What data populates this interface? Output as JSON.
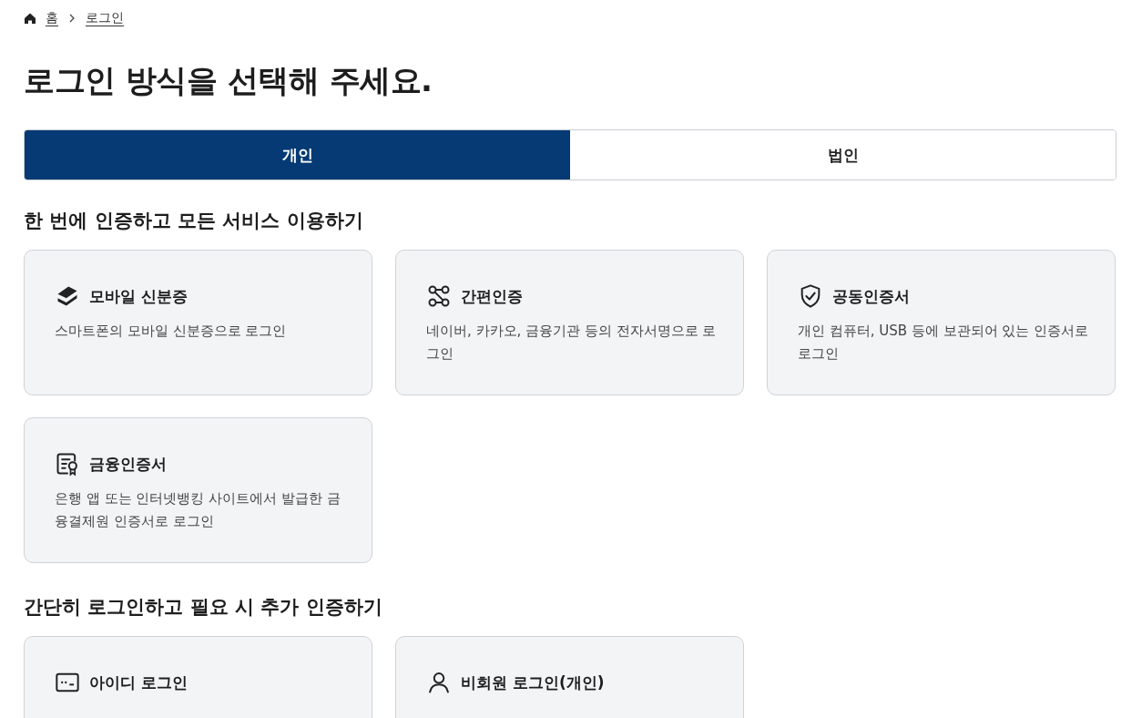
{
  "breadcrumb": [
    {
      "label": "홈",
      "kind": "home"
    },
    {
      "label": "로그인",
      "kind": "page"
    }
  ],
  "title": "로그인 방식을 선택해 주세요.",
  "tabs": [
    {
      "label": "개인",
      "selected": true
    },
    {
      "label": "법인",
      "selected": false
    }
  ],
  "sections": [
    {
      "heading": "한 번에 인증하고 모든 서비스 이용하기",
      "cards": [
        {
          "kind": "mobile-id",
          "title": "모바일 신분증",
          "description": "스마트폰의 모바일 신분증으로 로그인"
        },
        {
          "kind": "simple-auth",
          "title": "간편인증",
          "description": "네이버, 카카오, 금융기관 등의 전자서명으로 로그인"
        },
        {
          "kind": "joint-cert",
          "title": "공동인증서",
          "description": "개인 컴퓨터, USB 등에 보관되어 있는 인증서로 로그인"
        },
        {
          "kind": "finance-cert",
          "title": "금융인증서",
          "description": "은행 앱 또는 인터넷뱅킹 사이트에서 발급한 금융결제원 인증서로 로그인"
        }
      ]
    },
    {
      "heading": "간단히 로그인하고 필요 시 추가 인증하기",
      "cards": [
        {
          "kind": "id-login",
          "title": "아이디 로그인"
        },
        {
          "kind": "guest",
          "title": "비회원 로그인(개인)"
        }
      ]
    }
  ]
}
